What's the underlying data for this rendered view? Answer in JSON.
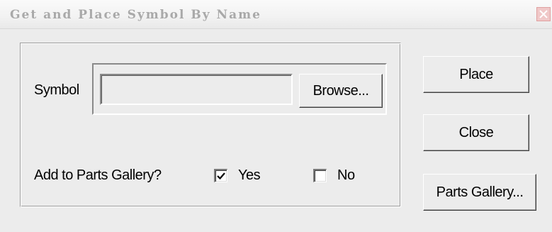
{
  "window": {
    "title": "Get and Place Symbol By Name",
    "close_icon": "close-icon"
  },
  "symbol": {
    "label": "Symbol",
    "value": "",
    "browse_label": "Browse..."
  },
  "gallery": {
    "label": "Add to Parts Gallery?",
    "yes_label": "Yes",
    "yes_checked": true,
    "no_label": "No",
    "no_checked": false
  },
  "actions": {
    "place_label": "Place",
    "close_label": "Close",
    "parts_gallery_label": "Parts Gallery..."
  },
  "colors": {
    "dialog_bg": "#ececec",
    "title_text": "#a9a9a9",
    "close_button_bg": "#f0c8c8"
  }
}
